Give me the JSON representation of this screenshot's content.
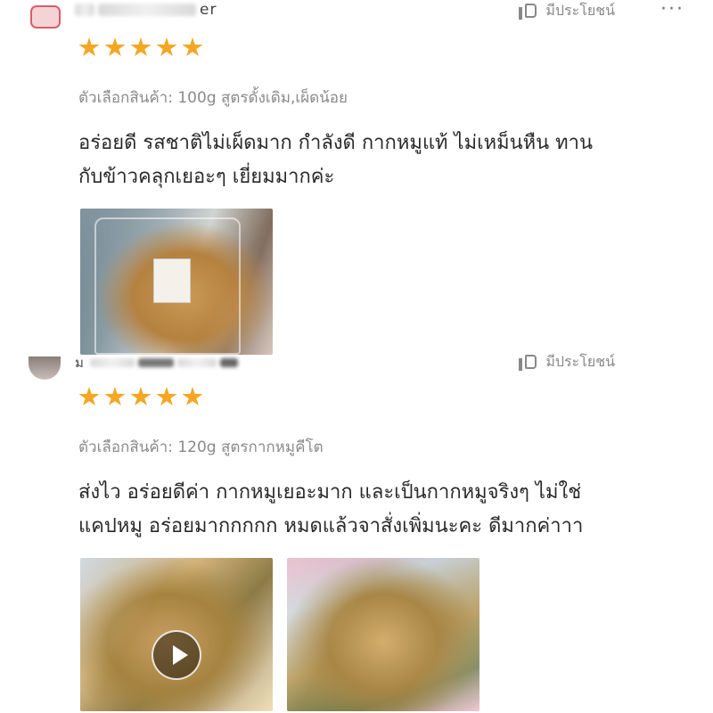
{
  "reviews": [
    {
      "username_tail": "er",
      "helpful_label": "มีประโยชน์",
      "more": "···",
      "rating": 5,
      "variation": "ตัวเลือกสินค้า: 100g สูตรดั้งเดิม,เผ็ดน้อย",
      "comment_lines": [
        "อร่อยดี รสชาติไม่เผ็ดมาก กำลังดี กากหมูแท้ ไม่เหม็นหืน ทาน",
        "กับข้าวคลุกเยอะๆ เยี่ยมมากค่ะ"
      ],
      "media": [
        {
          "type": "photo"
        }
      ]
    },
    {
      "username_tail": "ม",
      "helpful_label": "มีประโยชน์",
      "rating": 5,
      "variation": "ตัวเลือกสินค้า: 120g สูตรกากหมูคีโต",
      "comment_lines": [
        "ส่งไว อร่อยดีค่า กากหมูเยอะมาก และเป็นกากหมูจริงๆ ไม่ใช่",
        "แคปหมู อร่อยมากกกกก หมดแล้วจาสั่งเพิ่มนะคะ ดีมากค่าาา"
      ],
      "media": [
        {
          "type": "video"
        },
        {
          "type": "photo"
        }
      ]
    }
  ],
  "colors": {
    "star": "#f5a623",
    "muted_text": "#8a8a8a",
    "body_text": "#2a2a2a"
  },
  "icons": {
    "helpful": "thumbs-up-icon",
    "more": "more-dots-icon",
    "play": "play-icon",
    "star": "star-icon"
  }
}
